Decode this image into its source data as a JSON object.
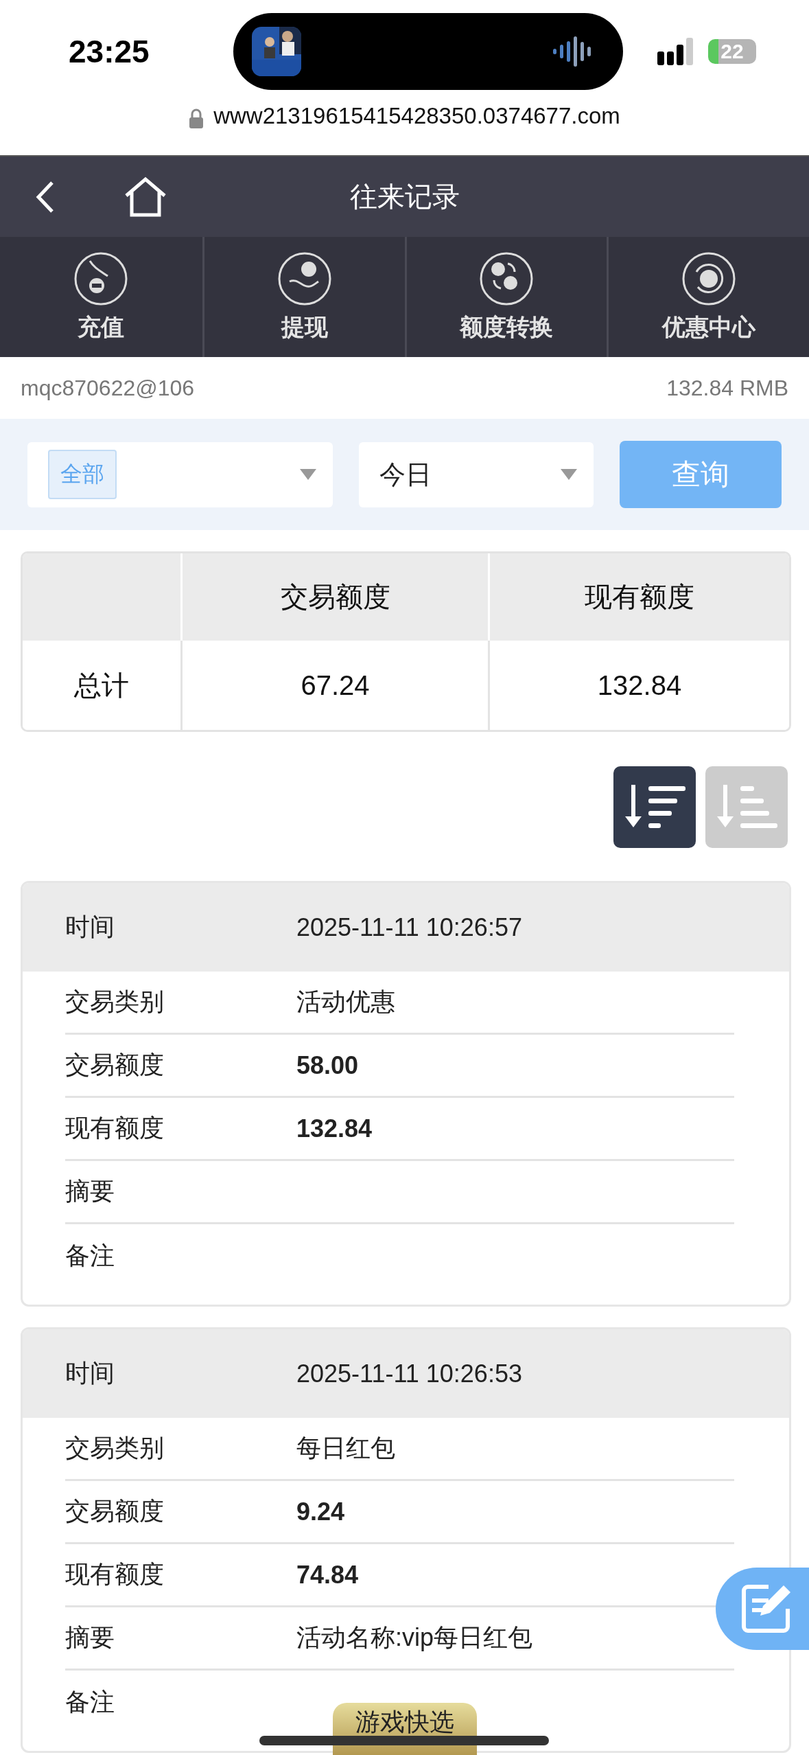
{
  "status_bar": {
    "time": "23:25",
    "battery": "22"
  },
  "browser": {
    "url": "www21319615415428350.0374677.com"
  },
  "nav": {
    "title": "往来记录"
  },
  "menu": [
    {
      "label": "充值",
      "kind": "deposit"
    },
    {
      "label": "提现",
      "kind": "withdraw"
    },
    {
      "label": "额度转换",
      "kind": "transfer"
    },
    {
      "label": "优惠中心",
      "kind": "promo"
    }
  ],
  "account": {
    "user": "mqc870622@106",
    "balance": "132.84 RMB"
  },
  "filters": {
    "type_tag": "全部",
    "period": "今日",
    "query_button": "查询"
  },
  "summary": {
    "columns": [
      "交易额度",
      "现有额度"
    ],
    "rows": [
      {
        "label": "总计",
        "cells": [
          "67.24",
          "132.84"
        ]
      }
    ]
  },
  "sort_buttons": [
    {
      "kind": "descending",
      "selected": true
    },
    {
      "kind": "ascending",
      "selected": false
    }
  ],
  "records": [
    {
      "time_label": "时间",
      "time": "2025-11-11 10:26:57",
      "fields": [
        {
          "label": "交易类别",
          "value": "活动优惠",
          "kind": "text"
        },
        {
          "label": "交易额度",
          "value": "58.00",
          "kind": "amount"
        },
        {
          "label": "现有额度",
          "value": "132.84",
          "kind": "amount"
        },
        {
          "label": "摘要"
        },
        {
          "label": "备注"
        }
      ]
    },
    {
      "time_label": "时间",
      "time": "2025-11-11 10:26:53",
      "fields": [
        {
          "label": "交易类别",
          "value": "每日红包",
          "kind": "text"
        },
        {
          "label": "交易额度",
          "value": "9.24",
          "kind": "amount"
        },
        {
          "label": "现有额度",
          "value": "74.84",
          "kind": "amount"
        },
        {
          "label": "摘要",
          "value": "活动名称:vip每日红包",
          "kind": "text"
        },
        {
          "label": "备注"
        }
      ]
    }
  ],
  "quick_pick": "游戏快选"
}
